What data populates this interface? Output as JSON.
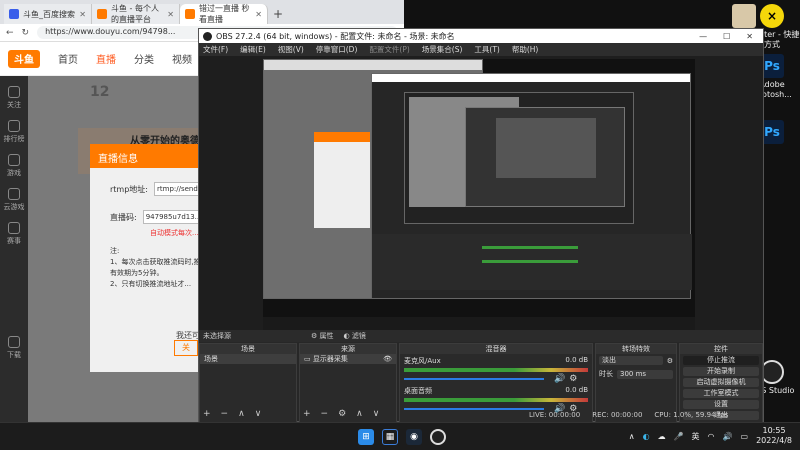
{
  "desktop": {
    "icons": [
      {
        "label": "",
        "name": "avatar-shortcut",
        "color": "#d8c8a8"
      },
      {
        "label": "",
        "name": "smiley-shortcut",
        "color": "#f5d70a"
      },
      {
        "label": "_arbiter - 快捷方式",
        "name": "arbiter-shortcut",
        "color": "#333333"
      },
      {
        "label": "Adobe Photosh...",
        "name": "photoshop-shortcut",
        "color": "#0b1f3c"
      },
      {
        "label": "",
        "name": "photoshop-shortcut-2",
        "color": "#0b1f3c"
      },
      {
        "label": "OBS Studio",
        "name": "obs-shortcut",
        "color": "#222222"
      }
    ]
  },
  "browser": {
    "tabs": [
      {
        "label": "斗鱼_百度搜索",
        "active": false
      },
      {
        "label": "斗鱼 - 每个人的直播平台",
        "active": false
      },
      {
        "label": "错过一直播 秒看直播",
        "active": true
      }
    ],
    "url": "https://www.douyu.com/94798...",
    "site_nav": [
      "首页",
      "直播",
      "分类",
      "视频",
      "游戏"
    ],
    "logo": "斗鱼",
    "left_nav": [
      "关注",
      "排行榜",
      "游戏",
      "云游戏",
      "赛事",
      "下载"
    ],
    "stat_value": "12",
    "banner_text": "从零开始的奥德赛",
    "modal": {
      "title": "直播信息",
      "rtmp_label": "rtmp地址:",
      "rtmp_value": "rtmp://sendtc3.douyu...",
      "key_label": "直播码:",
      "key_value": "947985u7d13...",
      "warning": "自动模式每次...",
      "note_title": "注:",
      "note_1": "1、每次点击获取推流码时,推流码的有效期为5分钟。",
      "note_2": "2、只有切换推流地址才...",
      "button": "关"
    },
    "footer_text": "我还可以..."
  },
  "obs": {
    "title": "OBS 27.2.4 (64 bit, windows) - 配置文件: 未命名 - 场景: 未命名",
    "menu": [
      "文件(F)",
      "编辑(E)",
      "视图(V)",
      "停靠窗口(D)",
      "配置文件(P)",
      "场景集合(S)",
      "工具(T)",
      "帮助(H)"
    ],
    "scene_bar": {
      "label": "未选择源",
      "properties": "属性",
      "filters": "滤镜"
    },
    "docks": {
      "scenes": {
        "title": "场景",
        "items": [
          "场景"
        ]
      },
      "sources": {
        "title": "来源",
        "items": [
          "显示器采集"
        ]
      },
      "mixer": {
        "title": "混音器",
        "channels": [
          {
            "name": "麦克风/Aux",
            "db": "0.0 dB"
          },
          {
            "name": "桌面音频",
            "db": "0.0 dB"
          }
        ]
      },
      "transitions": {
        "title": "转场特效",
        "type": "淡出",
        "duration_label": "时长",
        "duration": "300 ms"
      },
      "controls": {
        "title": "控件",
        "buttons": [
          "停止推流",
          "开始录制",
          "启动虚拟摄像机",
          "工作室模式",
          "设置",
          "退出"
        ]
      }
    },
    "status": {
      "live": "LIVE: 00:00:00",
      "rec": "REC: 00:00:00",
      "cpu": "CPU: 1.0%, 59.94 fps"
    }
  },
  "taskbar": {
    "apps": [
      "windows-start",
      "widgets-app",
      "steam-app",
      "obs-app"
    ],
    "tray": {
      "lang": "英",
      "time": "10:55",
      "date": "2022/4/8"
    }
  }
}
